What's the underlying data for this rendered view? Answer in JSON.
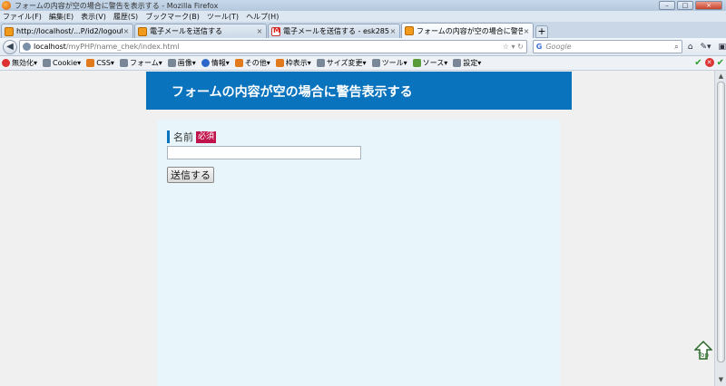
{
  "window": {
    "title": "フォームの内容が空の場合に警告を表示する - Mozilla Firefox"
  },
  "menu": [
    "ファイル(F)",
    "編集(E)",
    "表示(V)",
    "履歴(S)",
    "ブックマーク(B)",
    "ツール(T)",
    "ヘルプ(H)"
  ],
  "tabs": [
    {
      "label": "http://localhost/...P/id2/logout.php",
      "favicon": "php-icon",
      "close": "×"
    },
    {
      "label": "電子メールを送信する",
      "favicon": "php-icon",
      "close": "×"
    },
    {
      "label": "電子メールを送信する - esk285908...",
      "favicon": "gmail-icon",
      "close": "×"
    },
    {
      "label": "フォームの内容が空の場合に警告を...",
      "favicon": "php-icon",
      "close": "×",
      "active": true
    }
  ],
  "newtab_label": "+",
  "navbar": {
    "url_host": "localhost",
    "url_path": "/myPHP/name_chek/index.html",
    "search_placeholder": "Google",
    "search_engine": "G"
  },
  "devbar": {
    "items": [
      "無効化▾",
      "Cookie▾",
      "CSS▾",
      "フォーム▾",
      "画像▾",
      "情報▾",
      "その他▾",
      "枠表示▾",
      "サイズ変更▾",
      "ツール▾",
      "ソース▾",
      "設定▾"
    ]
  },
  "page": {
    "heading": "フォームの内容が空の場合に警告表示する",
    "field_label": "名前",
    "required_badge": "必須",
    "input_value": "",
    "submit_label": "送信する"
  },
  "colors": {
    "header_bg": "#0a73bd",
    "required_bg": "#c0124b",
    "main_bg": "#e8f6fc"
  }
}
